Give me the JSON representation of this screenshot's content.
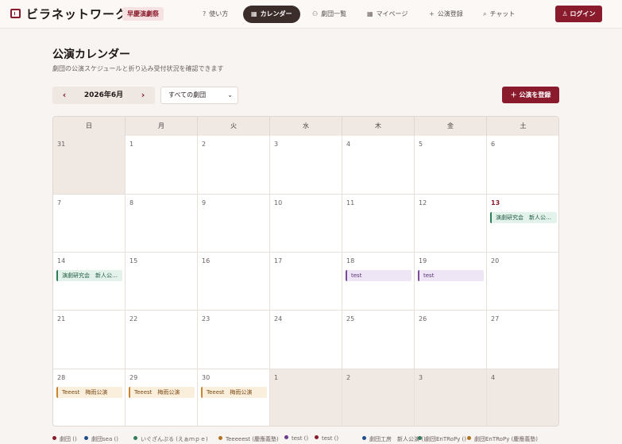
{
  "header": {
    "app_name": "ビラネットワーク",
    "festival_badge": "早慶演劇祭",
    "nav": [
      {
        "id": "howto",
        "label": "使い方",
        "icon": "help-icon"
      },
      {
        "id": "calendar",
        "label": "カレンダー",
        "icon": "calendar-icon",
        "active": true
      },
      {
        "id": "troupes",
        "label": "劇団一覧",
        "icon": "people-icon"
      },
      {
        "id": "mypage",
        "label": "マイページ",
        "icon": "grid-icon"
      },
      {
        "id": "register",
        "label": "公演登録",
        "icon": "plus-icon"
      },
      {
        "id": "chat",
        "label": "チャット",
        "icon": "chat-icon"
      }
    ],
    "login_label": "ログイン"
  },
  "page": {
    "title": "公演カレンダー",
    "subtitle": "劇団の公演スケジュールと折り込み受付状況を確認できます"
  },
  "toolbar": {
    "month_label": "2026年6月",
    "prev_symbol": "‹",
    "next_symbol": "›",
    "troupe_filter_value": "すべての劇団",
    "add_button_label": "＋ 公演を登録"
  },
  "calendar": {
    "weekdays": [
      "日",
      "月",
      "火",
      "水",
      "木",
      "金",
      "土"
    ],
    "weeks": [
      [
        {
          "d": "31",
          "other": true
        },
        {
          "d": "1"
        },
        {
          "d": "2"
        },
        {
          "d": "3"
        },
        {
          "d": "4"
        },
        {
          "d": "5"
        },
        {
          "d": "6"
        }
      ],
      [
        {
          "d": "7"
        },
        {
          "d": "8"
        },
        {
          "d": "9"
        },
        {
          "d": "10"
        },
        {
          "d": "11"
        },
        {
          "d": "12"
        },
        {
          "d": "13",
          "today": true,
          "events": [
            {
              "label": "演劇研究会　新人公…",
              "color": "green"
            }
          ]
        }
      ],
      [
        {
          "d": "14",
          "events": [
            {
              "label": "演劇研究会　新人公…",
              "color": "green"
            }
          ]
        },
        {
          "d": "15"
        },
        {
          "d": "16"
        },
        {
          "d": "17"
        },
        {
          "d": "18",
          "events": [
            {
              "label": "test",
              "color": "purple"
            }
          ]
        },
        {
          "d": "19",
          "events": [
            {
              "label": "test",
              "color": "purple"
            }
          ]
        },
        {
          "d": "20"
        }
      ],
      [
        {
          "d": "21"
        },
        {
          "d": "22"
        },
        {
          "d": "23"
        },
        {
          "d": "24"
        },
        {
          "d": "25"
        },
        {
          "d": "26"
        },
        {
          "d": "27"
        }
      ],
      [
        {
          "d": "28",
          "events": [
            {
              "label": "Teeest　梅雨公演",
              "color": "orange"
            }
          ]
        },
        {
          "d": "29",
          "events": [
            {
              "label": "Teeest　梅雨公演",
              "color": "orange"
            }
          ]
        },
        {
          "d": "30",
          "events": [
            {
              "label": "Teeest　梅雨公演",
              "color": "orange"
            }
          ]
        },
        {
          "d": "1",
          "other": true
        },
        {
          "d": "2",
          "other": true
        },
        {
          "d": "3",
          "other": true
        },
        {
          "d": "4",
          "other": true
        }
      ]
    ]
  },
  "legend": [
    {
      "label": "劇団 ()",
      "color": "#8a1b2c"
    },
    {
      "label": "劇団sea ()",
      "color": "#1f4e8c"
    },
    {
      "label": "いぐざんぷる (えぁｍｐｅ)",
      "color": "#2f7d58"
    },
    {
      "label": "Teeeeest (慶應義塾)",
      "color": "#b0731e"
    },
    {
      "label": "test ()",
      "color": "#6a3a8c"
    },
    {
      "label": "test ()",
      "color": "#8a1b2c"
    },
    {
      "label": "劇団工房　新人公演 ()",
      "color": "#1f4e8c"
    },
    {
      "label": "劇団EnTRoPy ()",
      "color": "#2f7d58"
    },
    {
      "label": "劇団EnTRoPy (慶應義塾)",
      "color": "#b0731e"
    }
  ]
}
